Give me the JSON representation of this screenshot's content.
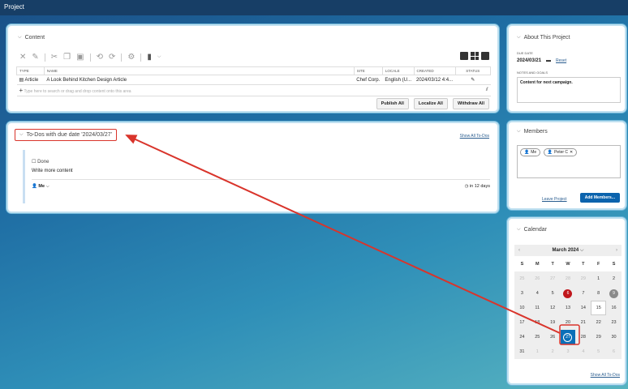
{
  "app": {
    "title": "Project"
  },
  "content_panel": {
    "title": "Content",
    "table": {
      "headers": [
        "TYPE",
        "NAME",
        "SITE",
        "LOCALE",
        "CREATED",
        "STATUS"
      ],
      "rows": [
        {
          "type": "Article",
          "name": "A Look Behind Kitchen Design Article",
          "site": "Chef Corp.",
          "locale": "English (U...",
          "created": "2024/03/12 4:4..."
        }
      ],
      "add_placeholder": "Type here to search or drag and drop content onto this area"
    },
    "buttons": {
      "publish": "Publish All",
      "localize": "Localize All",
      "withdraw": "Withdraw All"
    }
  },
  "todos_panel": {
    "title": "To-Dos with due date '2024/03/27'",
    "show_all": "Show All To-Dos",
    "item": {
      "done_label": "Done",
      "text": "Write more content",
      "assignee": "Me",
      "due": "in 12 days"
    }
  },
  "about_panel": {
    "title": "About This Project",
    "due_date_label": "DUE DATE",
    "due_date": "2024/03/21",
    "reset": "Reset",
    "notes_label": "NOTES AND GOALS",
    "notes": "Content for next campaign."
  },
  "members_panel": {
    "title": "Members",
    "members": [
      "Me",
      "Peter C"
    ],
    "leave": "Leave Project",
    "add": "Add Members..."
  },
  "calendar_panel": {
    "title": "Calendar",
    "month": "March 2024",
    "weekdays": [
      "S",
      "M",
      "T",
      "W",
      "T",
      "F",
      "S"
    ],
    "weeks": [
      [
        "25",
        "26",
        "27",
        "28",
        "29",
        "1",
        "2"
      ],
      [
        "3",
        "4",
        "5",
        "6",
        "7",
        "8",
        "9"
      ],
      [
        "10",
        "11",
        "12",
        "13",
        "14",
        "15",
        "16"
      ],
      [
        "17",
        "18",
        "19",
        "20",
        "21",
        "22",
        "23"
      ],
      [
        "24",
        "25",
        "26",
        "27",
        "28",
        "29",
        "30"
      ],
      [
        "31",
        "1",
        "2",
        "3",
        "4",
        "5",
        "6"
      ]
    ],
    "show_all": "Show All To-Dos",
    "colors": {
      "today": "#c0171c",
      "selected": "#0b6fb8",
      "marked": "#8a8a8a",
      "annotation": "#d9342b"
    }
  }
}
